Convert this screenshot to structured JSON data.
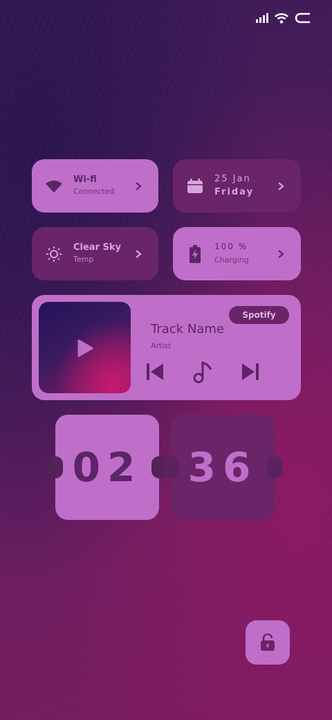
{
  "status_bar": {
    "icons": [
      "signal-icon",
      "wifi-icon",
      "battery-icon"
    ]
  },
  "wifi": {
    "title": "Wi-fi",
    "subtitle": "Connected"
  },
  "date": {
    "line1": "25 Jan",
    "line2": "Friday"
  },
  "weather": {
    "title": "Clear Sky",
    "subtitle": "Temp"
  },
  "battery": {
    "title": "100 %",
    "subtitle": "Charging"
  },
  "music": {
    "source": "Spotify",
    "track": "Track Name",
    "artist": "Artist"
  },
  "clock": {
    "hours": "02",
    "minutes": "36"
  },
  "colors": {
    "light_card": "#bf6fc9",
    "dark_card": "#6a2468",
    "text_dark": "#5b2566"
  }
}
